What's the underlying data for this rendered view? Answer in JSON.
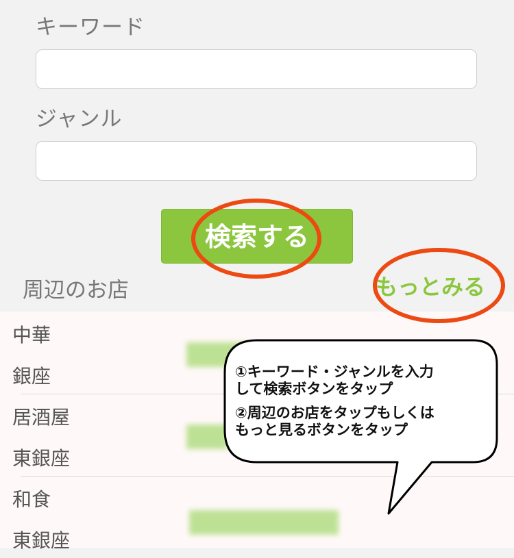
{
  "form": {
    "keyword_label": "キーワード",
    "keyword_value": "",
    "genre_label": "ジャンル",
    "genre_value": "",
    "search_button": "検索する"
  },
  "nearby": {
    "title": "周辺のお店",
    "more": "もっとみる",
    "shops": [
      {
        "category": "中華",
        "area": "銀座"
      },
      {
        "category": "居酒屋",
        "area": "東銀座"
      },
      {
        "category": "和食",
        "area": "東銀座"
      }
    ]
  },
  "callout": {
    "step1": "①キーワード・ジャンルを入力\nして検索ボタンをタップ",
    "step2": "②周辺のお店をタップもしくは\nもっと見るボタンをタップ"
  },
  "colors": {
    "accent": "#8cc63f",
    "highlight": "#ec4a12"
  }
}
